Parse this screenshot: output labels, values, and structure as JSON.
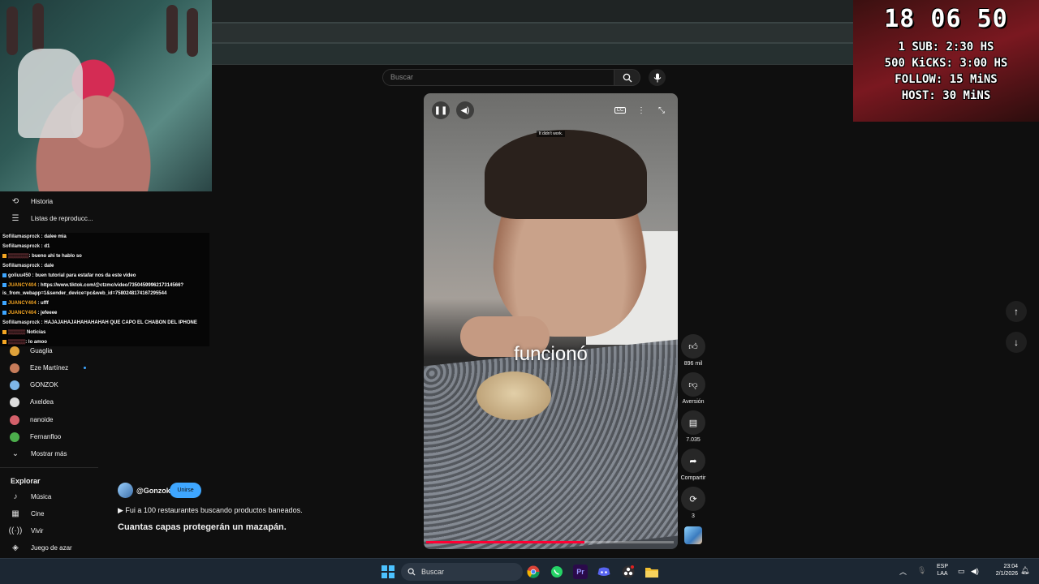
{
  "overlay": {
    "clock": "18 06 50",
    "goals": [
      "1 SUB: 2:30 HS",
      "500 KiCKS: 3:00 HS",
      "FOLLOW: 15 MiNS",
      "HOST: 30 MiNS"
    ]
  },
  "sidebar": {
    "top_items": [
      {
        "label": "Historia",
        "icon": "history-icon"
      },
      {
        "label": "Listas de reproducc...",
        "icon": "playlist-icon"
      }
    ],
    "subscriptions": [
      {
        "label": "Guaglia",
        "color": "#e0a23a"
      },
      {
        "label": "Eze Martínez",
        "color": "#c77c5a",
        "live": true
      },
      {
        "label": "GONZOK",
        "color": "#7eb6e8"
      },
      {
        "label": "Axeldea",
        "color": "#ddd"
      },
      {
        "label": "nanoide",
        "color": "#d4606a"
      },
      {
        "label": "Fernanfloo",
        "color": "#4cae4c"
      }
    ],
    "show_more": "Mostrar más",
    "explore_title": "Explorar",
    "explore_items": [
      {
        "label": "Música",
        "icon": "music-icon"
      },
      {
        "label": "Cine",
        "icon": "film-icon"
      },
      {
        "label": "Vivir",
        "icon": "live-icon"
      },
      {
        "label": "Juego de azar",
        "icon": "gaming-icon"
      }
    ]
  },
  "chat": {
    "messages": [
      {
        "user": "Sofiilamasprozk",
        "text": "dalee mia",
        "orange": false
      },
      {
        "user": "Sofiilamasprozk",
        "text": "d1",
        "orange": false
      },
      {
        "user": "",
        "text": ": bueno ahi te hablo so",
        "orange": false
      },
      {
        "user": "Sofiilamasprozk",
        "text": "dale",
        "orange": false
      },
      {
        "user": "goliuu450",
        "text": "buen tutorial para estafar nos da este video",
        "orange": false
      },
      {
        "user": "JUANCY404",
        "text": "https://www.tiktok.com/@ctzmc/video/7350459996217314566?",
        "orange": true
      },
      {
        "user": "",
        "text": "is_from_webapp=1&sender_device=pc&web_id=7580248174167295544",
        "orange": false
      },
      {
        "user": "JUANCY404",
        "text": "ufff",
        "orange": true
      },
      {
        "user": "JUANCY404",
        "text": "jefeeee",
        "orange": true
      },
      {
        "user": "Sofiilamasprozk",
        "text": "HAJAJAHAJAHAHAHAHAH QUE CAPO EL CHABON DEL IPHONE",
        "orange": false
      },
      {
        "user": "",
        "text": "Noticias",
        "orange": false
      },
      {
        "user": "",
        "text": ": lo amoo",
        "orange": false
      }
    ]
  },
  "search": {
    "placeholder": "Buscar"
  },
  "video": {
    "caption_small": "It didn't work.",
    "caption": "funcionó",
    "progress": 0.64
  },
  "actions": {
    "likes": "896 mil",
    "dislike": "Aversión",
    "comments": "7.035",
    "share": "Compartir",
    "remix": "3"
  },
  "meta": {
    "handle": "@Gonzok",
    "join": "Unirse",
    "link": "Fui a 100 restaurantes buscando productos baneados.",
    "title": "Cuantas capas protegerán un mazapán."
  },
  "taskbar": {
    "search": "Buscar",
    "lang": "ESP",
    "region": "LAA",
    "time": "23:04",
    "date": "2/1/2026"
  }
}
